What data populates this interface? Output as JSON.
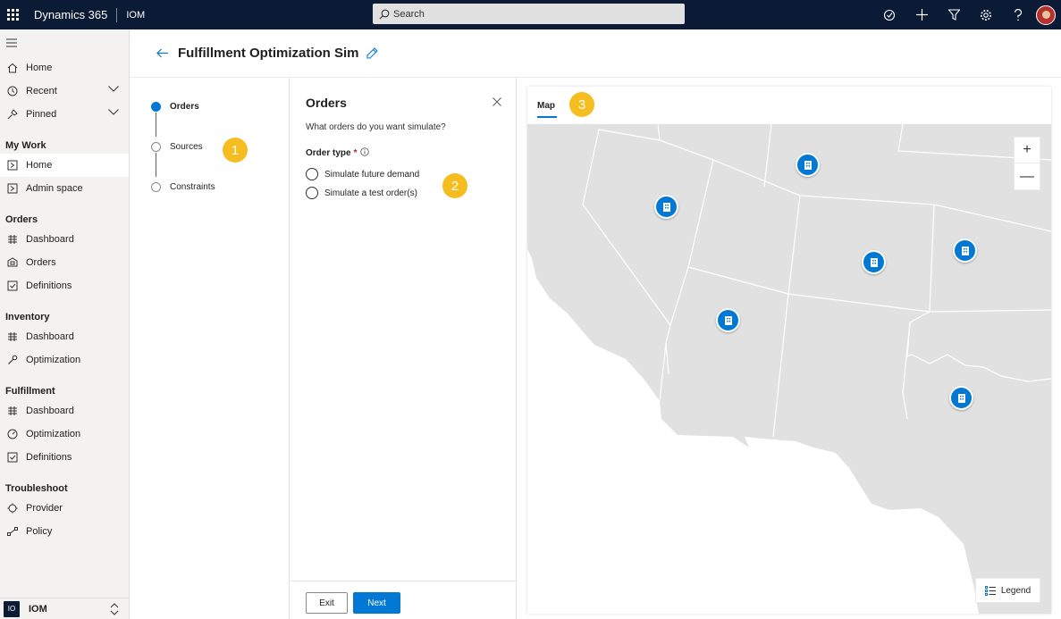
{
  "topbar": {
    "app_name": "Dynamics 365",
    "area_name": "IOM",
    "search_placeholder": "Search"
  },
  "sidebar": {
    "items": [
      {
        "label": "Home",
        "icon": "home-icon"
      },
      {
        "label": "Recent",
        "icon": "clock-icon"
      },
      {
        "label": "Pinned",
        "icon": "pin-icon"
      }
    ],
    "sections": [
      {
        "title": "My Work",
        "items": [
          {
            "label": "Home",
            "icon": "home-page-icon"
          },
          {
            "label": "Admin space",
            "icon": "page-icon"
          }
        ]
      },
      {
        "title": "Orders",
        "items": [
          {
            "label": "Dashboard",
            "icon": "dashboard-icon"
          },
          {
            "label": "Orders",
            "icon": "orders-icon"
          },
          {
            "label": "Definitions",
            "icon": "checklist-icon"
          }
        ]
      },
      {
        "title": "Inventory",
        "items": [
          {
            "label": "Dashboard",
            "icon": "dashboard-icon"
          },
          {
            "label": "Optimization",
            "icon": "wrench-icon"
          }
        ]
      },
      {
        "title": "Fulfillment",
        "items": [
          {
            "label": "Dashboard",
            "icon": "dashboard-icon"
          },
          {
            "label": "Optimization",
            "icon": "gauge-icon"
          },
          {
            "label": "Definitions",
            "icon": "checklist-icon"
          }
        ]
      },
      {
        "title": "Troubleshoot",
        "items": [
          {
            "label": "Provider",
            "icon": "plug-icon"
          },
          {
            "label": "Policy",
            "icon": "flow-icon"
          }
        ]
      }
    ],
    "footer": {
      "badge": "IO",
      "name": "IOM"
    }
  },
  "header": {
    "title": "Fulfillment Optimization Sim"
  },
  "stepper": {
    "steps": [
      {
        "label": "Orders",
        "active": true
      },
      {
        "label": "Sources",
        "active": false
      },
      {
        "label": "Constraints",
        "active": false
      }
    ]
  },
  "badges": [
    "1",
    "2",
    "3"
  ],
  "panel": {
    "title": "Orders",
    "question": "What orders do you want simulate?",
    "field_label": "Order type",
    "required_mark": "*",
    "options": [
      "Simulate future demand",
      "Simulate a test order(s)"
    ],
    "exit_label": "Exit",
    "next_label": "Next"
  },
  "map": {
    "tab_label": "Map",
    "legend_label": "Legend",
    "zoom_in": "+",
    "zoom_out": "—"
  },
  "colors": {
    "accent": "#0078d4",
    "topbar": "#0b1a35",
    "badge": "#f5bd1f",
    "land": "#e1e1e1"
  }
}
